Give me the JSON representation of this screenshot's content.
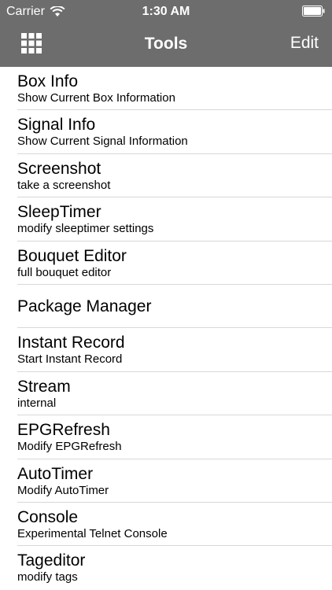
{
  "status_bar": {
    "carrier": "Carrier",
    "time": "1:30 AM"
  },
  "nav": {
    "title": "Tools",
    "edit_label": "Edit",
    "grid_icon": "grid-menu-icon"
  },
  "colors": {
    "header_bg": "#6d6d6d",
    "separator": "#d8d8dc"
  },
  "items": [
    {
      "title": "Box Info",
      "subtitle": "Show Current Box Information"
    },
    {
      "title": "Signal Info",
      "subtitle": "Show Current Signal Information"
    },
    {
      "title": "Screenshot",
      "subtitle": "take a screenshot"
    },
    {
      "title": "SleepTimer",
      "subtitle": "modify sleeptimer settings"
    },
    {
      "title": "Bouquet Editor",
      "subtitle": "full bouquet editor"
    },
    {
      "title": "Package Manager",
      "subtitle": ""
    },
    {
      "title": "Instant Record",
      "subtitle": "Start Instant Record"
    },
    {
      "title": "Stream",
      "subtitle": "internal"
    },
    {
      "title": "EPGRefresh",
      "subtitle": "Modify EPGRefresh"
    },
    {
      "title": "AutoTimer",
      "subtitle": "Modify AutoTimer"
    },
    {
      "title": "Console",
      "subtitle": "Experimental Telnet Console"
    },
    {
      "title": "Tageditor",
      "subtitle": "modify tags"
    }
  ]
}
